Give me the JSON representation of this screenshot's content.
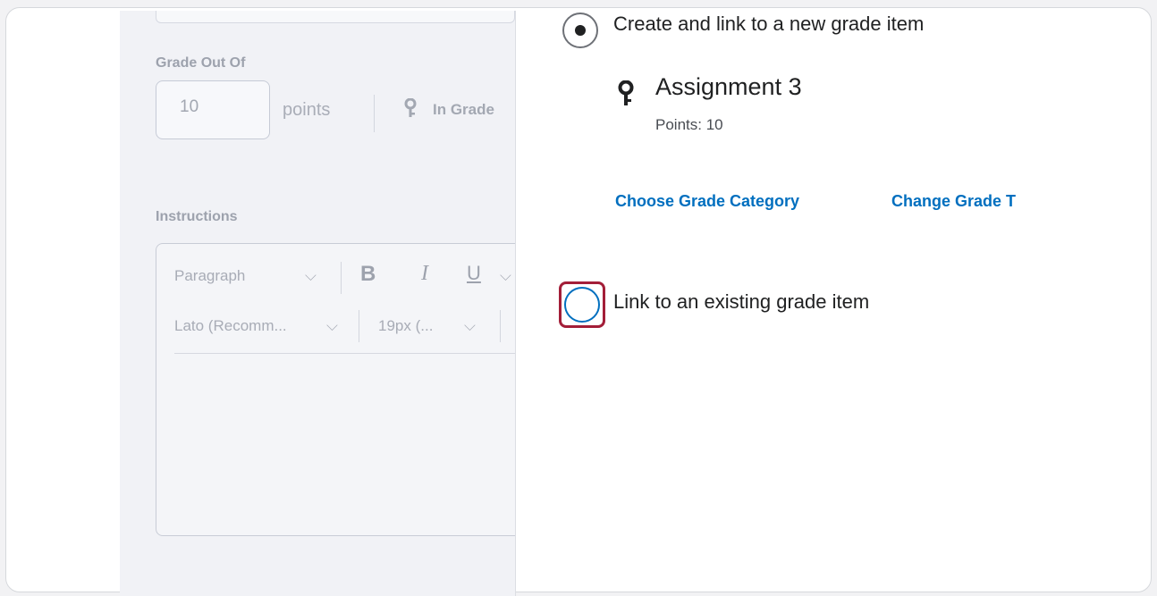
{
  "left_form": {
    "grade_out_of_label": "Grade Out Of",
    "grade_value": "10",
    "points_label": "points",
    "in_grade_label": "In Grade",
    "instructions_label": "Instructions",
    "toolbar": {
      "paragraph": "Paragraph",
      "bold": "B",
      "italic": "I",
      "underline": "U",
      "font": "Lato (Recomm...",
      "size": "19px (..."
    }
  },
  "dialog": {
    "option_new_label": "Create and link to a new grade item",
    "new_item_name": "Assignment 3",
    "new_item_points": "Points: 10",
    "choose_category_link": "Choose Grade Category",
    "change_type_link": "Change Grade T",
    "option_existing_label": "Link to an existing grade item"
  },
  "colors": {
    "link": "#006fbf",
    "highlight": "#a31e38"
  }
}
